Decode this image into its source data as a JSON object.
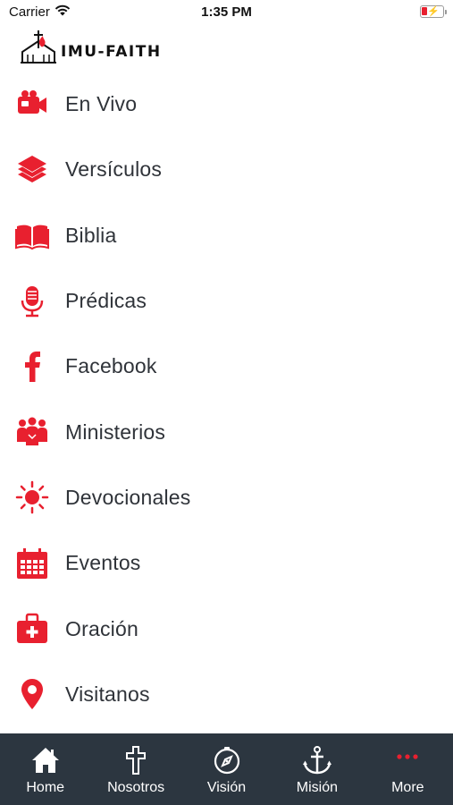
{
  "status_bar": {
    "carrier": "Carrier",
    "time": "1:35 PM"
  },
  "header": {
    "logo_text": "IMU-FAITH"
  },
  "menu": {
    "items": [
      {
        "label": "En Vivo",
        "icon": "video-camera-icon"
      },
      {
        "label": "Versículos",
        "icon": "layers-icon"
      },
      {
        "label": "Biblia",
        "icon": "open-book-icon"
      },
      {
        "label": "Prédicas",
        "icon": "microphone-icon"
      },
      {
        "label": "Facebook",
        "icon": "facebook-icon"
      },
      {
        "label": "Ministerios",
        "icon": "people-group-icon"
      },
      {
        "label": "Devocionales",
        "icon": "sun-icon"
      },
      {
        "label": "Eventos",
        "icon": "calendar-icon"
      },
      {
        "label": "Oración",
        "icon": "first-aid-kit-icon"
      },
      {
        "label": "Visitanos",
        "icon": "map-pin-icon"
      }
    ]
  },
  "tab_bar": {
    "tabs": [
      {
        "label": "Home",
        "icon": "home-icon"
      },
      {
        "label": "Nosotros",
        "icon": "cross-icon"
      },
      {
        "label": "Visión",
        "icon": "compass-icon"
      },
      {
        "label": "Misión",
        "icon": "anchor-icon"
      },
      {
        "label": "More",
        "icon": "more-dots-icon"
      }
    ]
  },
  "colors": {
    "accent": "#e8202f",
    "tab_bar_bg": "#2c3640",
    "text": "#2f3339",
    "tab_text": "#ffffff"
  }
}
